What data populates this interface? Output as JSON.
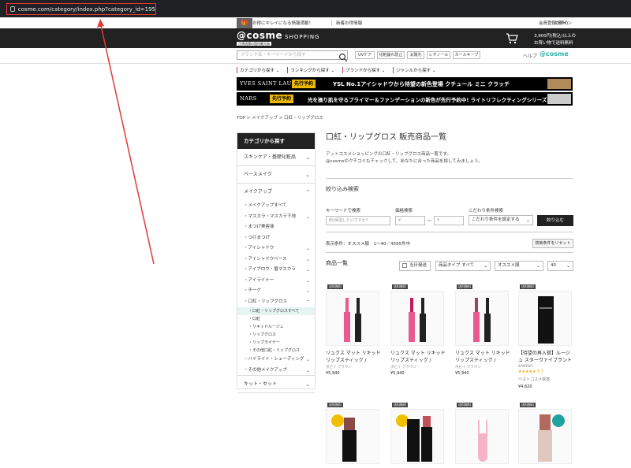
{
  "browser": {
    "url": "cosme.com/category/index.php?category_id=195"
  },
  "promo": {
    "text1": "お得にキレイになる情報満載！",
    "text2": "新着お得情報",
    "link_register": "会員登録(無料)",
    "link_login": "ログイン"
  },
  "header": {
    "logo": "@cosme",
    "logo_suffix": "SHOPPING",
    "logo_sub": "正規流通の国内最大級",
    "shipping_line1": "3,900円(税込)以上の",
    "shipping_line2": "お買い物で送料無料"
  },
  "search": {
    "placeholder": "ブランド名・キーワードから探す",
    "tags": [
      "UVケア",
      "化粧崩れ防止",
      "太陽光",
      "レチノール",
      "カールキープ"
    ],
    "help": "ヘルプ",
    "cosme_link": "@cosme"
  },
  "category_nav": [
    "カテゴリから探す ⌄",
    "ランキングから探す ⌄",
    "ブランドから探す ⌄",
    "ジャンルから探す ⌄"
  ],
  "banners": [
    {
      "brand": "YVES SAINT LAURENT",
      "pre": "先行予約",
      "text": "YSL No.1アイシャドウから待望の新色登場 クチュール ミニ クラッチ"
    },
    {
      "brand": "NARS",
      "pre": "先行予約",
      "text": "光を操り肌を守るプライマー＆ファンデーションの新色が先行予約中! ライトリフレクティングシリーズ"
    }
  ],
  "breadcrumb": "TOP > メイクアップ > 口紅・リップグロス",
  "sidebar": {
    "title": "カテゴリから探す",
    "top_items": [
      "スキンケア・基礎化粧品",
      "ベースメイク",
      "メイクアップ"
    ],
    "makeup_items": [
      "・メイクアップすべて",
      "・マスカラ・マスカラ下地",
      "・まつげ美容液",
      "・つけまつげ",
      "・アイシャドウ",
      "・アイシャドウベース",
      "・アイブロウ・眉マスカラ",
      "・アイライナー",
      "・チーク",
      "・口紅・リップグロス"
    ],
    "lip_items": [
      "・口紅・リップグロスすべて",
      "・口紅",
      "・リキッドルージュ",
      "・リップグロス",
      "・リップライナー",
      "・その他口紅・リップグロス"
    ],
    "after_items": [
      "・ハイライト・シェーディング",
      "・その他メイクアップ"
    ],
    "bottom_item": "キット・セット"
  },
  "page": {
    "title": "口紅・リップグロス 販売商品一覧",
    "desc1": "アットコスメショッピングの口紅・リップグロス商品一覧です。",
    "desc2": "@cosmeのクチコミもチェックして、あなたに合った商品を探してみましょう。"
  },
  "filter": {
    "heading": "絞り込み検索",
    "kw_label": "キーワードで検索",
    "kw_placeholder": "例)保湿したいですか？",
    "price_label": "価格検索",
    "price_from": "¥",
    "price_sep": "〜",
    "price_to": "¥",
    "cond_label": "こだわり条件検索",
    "cond_value": "こだわり条件を設定する",
    "apply": "絞り込む",
    "status": "表示条件：オススメ順　1〜40／4595件中",
    "reset": "検索条件をリセット"
  },
  "list": {
    "heading": "商品一覧",
    "sameday": "当日発送",
    "type": "商品タイプ すべて",
    "sort": "オススメ順",
    "count": "40"
  },
  "products": [
    {
      "badge": "送料無料",
      "name": "リュクス マット リキッド リップスティック / L04…",
      "brand": "ボビイ ブラウン",
      "price": "¥5,940"
    },
    {
      "badge": "送料無料",
      "name": "リュクス マット リキッド リップスティック / L64…",
      "brand": "ボビイ ブラウン",
      "price": "¥5,940"
    },
    {
      "badge": "送料無料",
      "name": "リュクス マット リキッド リップスティック / L40…",
      "brand": "ボビイ ブラウン",
      "price": "¥5,940"
    },
    {
      "badge": "送料無料",
      "name": "【待望の再入荷】ルージュ スターヴァイブラント / …",
      "brand": "KANEBO",
      "stars": "★★★★★ 5.7",
      "best": "ベストコスメ受賞",
      "price": "¥4,620"
    }
  ],
  "row2_badges": [
    "送料無料",
    "送料無料",
    "送料無料",
    "送料無料"
  ],
  "colors": {
    "accent": "#2bb2a7",
    "highlight": "#e53935",
    "banner": "#000000",
    "badge": "#f0b900"
  }
}
